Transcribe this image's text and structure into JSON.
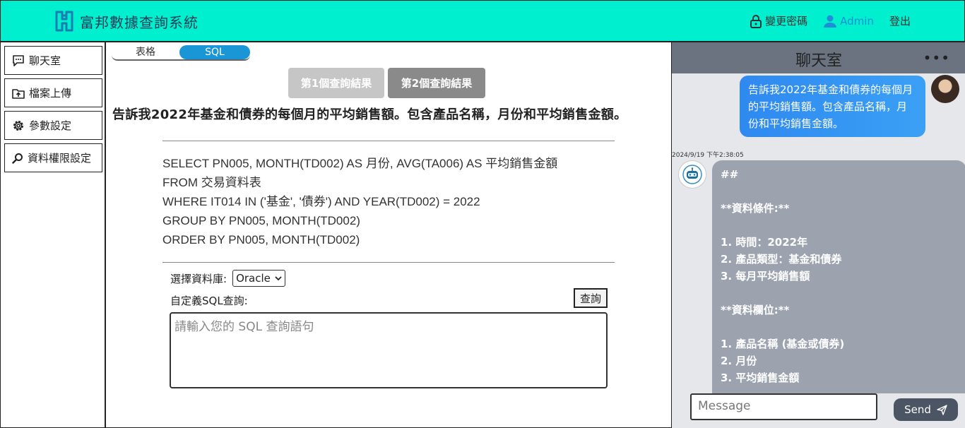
{
  "header": {
    "title": "富邦數據查詢系統",
    "change_password": "變更密碼",
    "admin": "Admin",
    "logout": "登出"
  },
  "sidebar": {
    "items": [
      {
        "label": "聊天室",
        "icon": "chat-bubble-icon"
      },
      {
        "label": "檔案上傳",
        "icon": "folder-upload-icon"
      },
      {
        "label": "參數設定",
        "icon": "gear-icon"
      },
      {
        "label": "資料權限設定",
        "icon": "search-icon"
      }
    ]
  },
  "main": {
    "tabs": {
      "table": "表格",
      "sql": "SQL",
      "active": "SQL"
    },
    "results": {
      "first": "第1個查詢結果",
      "second": "第2個查詢結果"
    },
    "question": "告訴我2022年基金和債券的每個月的平均銷售額。包含產品名稱，月份和平均銷售金額。",
    "sql_lines": [
      "SELECT PN005, MONTH(TD002) AS 月份, AVG(TA006) AS 平均銷售金額",
      "FROM 交易資料表",
      "WHERE IT014 IN ('基金', '債券') AND YEAR(TD002) = 2022",
      "GROUP BY PN005, MONTH(TD002)",
      "ORDER BY PN005, MONTH(TD002)"
    ],
    "db_label": "選擇資料庫:",
    "db_selected": "Oracle",
    "custom_label": "自定義SQL查詢:",
    "query_button": "查詢",
    "sql_placeholder": "請輸入您的 SQL 查詢語句"
  },
  "chat": {
    "title": "聊天室",
    "user_message": "告訴我2022年基金和債券的每個月的平均銷售額。包含產品名稱，月份和平均銷售金額。",
    "timestamp": "2024/9/19 下午2:38:05",
    "bot_lines": [
      "##",
      "",
      "**資料條件:**",
      "",
      "1. 時間：2022年",
      "2. 產品類型：基金和債券",
      "3. 每月平均銷售額",
      "",
      "**資料欄位:**",
      "",
      "1. 產品名稱 (基金或債券)",
      "2. 月份",
      "3. 平均銷售金額"
    ],
    "input_placeholder": "Message",
    "send_label": "Send"
  },
  "colors": {
    "header_bg": "#00efcf",
    "accent_blue": "#1a95d6",
    "chat_bg": "#e5e7eb",
    "bot_bubble": "#9ca3af"
  }
}
